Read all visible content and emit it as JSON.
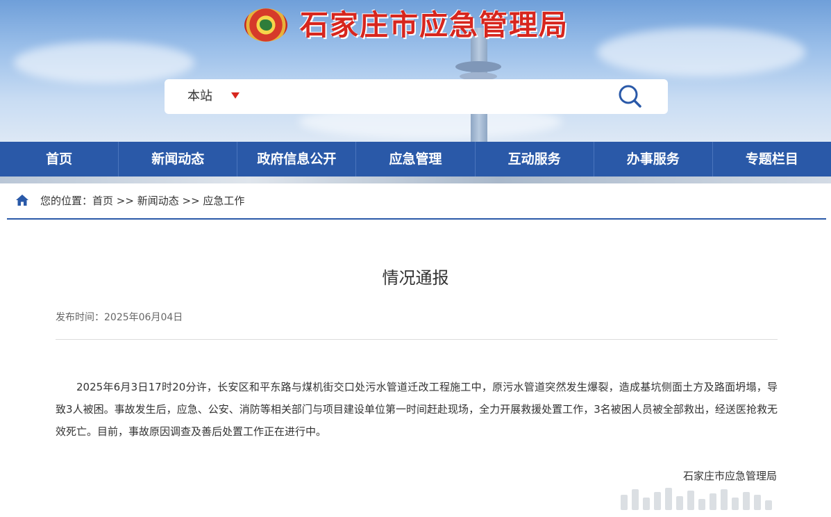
{
  "header": {
    "site_title": "石家庄市应急管理局",
    "search": {
      "scope": "本站",
      "placeholder": ""
    },
    "accent_color": "#d7261e"
  },
  "nav": {
    "items": [
      {
        "label": "首页"
      },
      {
        "label": "新闻动态"
      },
      {
        "label": "政府信息公开"
      },
      {
        "label": "应急管理"
      },
      {
        "label": "互动服务"
      },
      {
        "label": "办事服务"
      },
      {
        "label": "专题栏目"
      }
    ],
    "bg_color": "#2a59a8"
  },
  "breadcrumb": {
    "prefix": "您的位置：",
    "items": [
      "首页",
      "新闻动态",
      "应急工作"
    ],
    "separator": " >> "
  },
  "article": {
    "title": "情况通报",
    "publish_label": "发布时间：",
    "publish_date": "2025年06月04日",
    "body": "2025年6月3日17时20分许，长安区和平东路与煤机街交口处污水管道迁改工程施工中，原污水管道突然发生爆裂，造成基坑侧面土方及路面坍塌，导致3人被困。事故发生后，应急、公安、消防等相关部门与项目建设单位第一时间赶赴现场，全力开展救援处置工作，3名被困人员被全部救出，经送医抢救无效死亡。目前，事故原因调查及善后处置工作正在进行中。",
    "signature": "石家庄市应急管理局"
  }
}
